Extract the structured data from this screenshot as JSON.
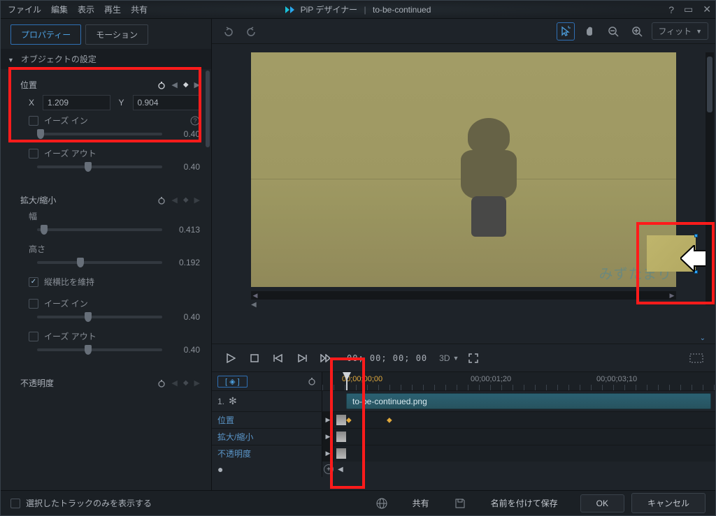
{
  "app": {
    "title": "PiP デザイナー",
    "document": "to-be-continued"
  },
  "menu": {
    "file": "ファイル",
    "edit": "編集",
    "view": "表示",
    "play": "再生",
    "share": "共有"
  },
  "tabs": {
    "properties": "プロパティー",
    "motion": "モーション"
  },
  "section": {
    "object_settings": "オブジェクトの設定"
  },
  "position": {
    "label": "位置",
    "x_label": "X",
    "x_value": "1.209",
    "y_label": "Y",
    "y_value": "0.904",
    "ease_in": "イーズ イン",
    "ease_in_val": "0.40",
    "ease_out": "イーズ アウト",
    "ease_out_val": "0.40"
  },
  "scale": {
    "label": "拡大/縮小",
    "width_label": "幅",
    "width_val": "0.413",
    "height_label": "高さ",
    "height_val": "0.192",
    "keep_aspect": "縦横比を維持",
    "ease_in": "イーズ イン",
    "ease_in_val": "0.40",
    "ease_out": "イーズ アウト",
    "ease_out_val": "0.40"
  },
  "opacity": {
    "label": "不透明度"
  },
  "viewer": {
    "fit": "フィット",
    "watermark": "みずたまり"
  },
  "playback": {
    "timecode": "00; 00; 00; 00",
    "three_d": "3D"
  },
  "timeline": {
    "ruler": {
      "t0": "00;00;00;00",
      "t1": "00;00;01;20",
      "t2": "00;00;03;10"
    },
    "track1_label": "1.",
    "clip_name": "to-be-continued.png",
    "prop_position": "位置",
    "prop_scale": "拡大/縮小",
    "prop_opacity": "不透明度"
  },
  "footer": {
    "show_selected_only": "選択したトラックのみを表示する",
    "share": "共有",
    "save_as": "名前を付けて保存",
    "ok": "OK",
    "cancel": "キャンセル"
  }
}
